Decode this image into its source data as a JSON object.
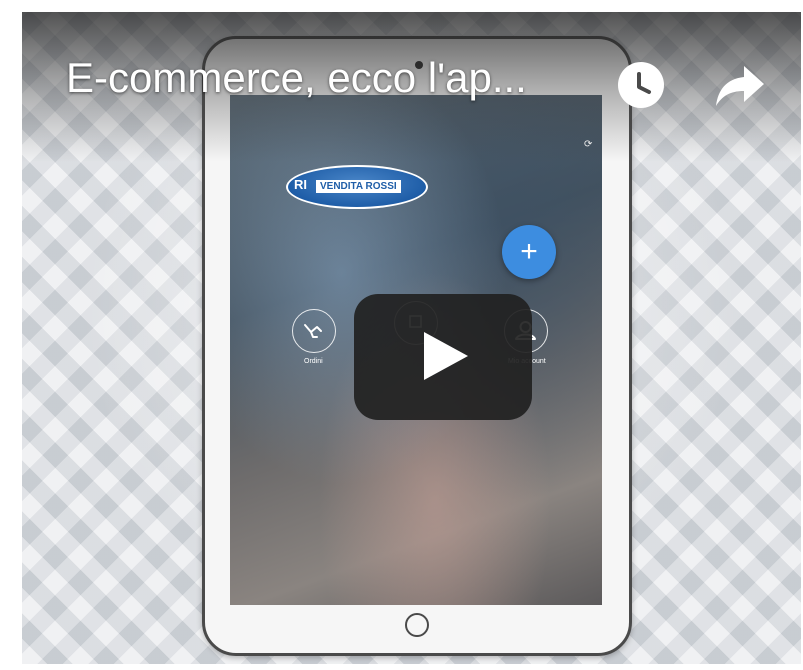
{
  "video": {
    "title": "E-commerce, ecco l'ap...",
    "watch_later_icon": "clock-icon",
    "share_icon": "share-arrow-icon",
    "play_icon": "play-icon"
  },
  "app_screen": {
    "logo_prefix": "RI",
    "logo_text": "VENDITA ROSSI",
    "fab_label": "+",
    "buttons": [
      {
        "label": "Ordini",
        "icon": "order-icon"
      },
      {
        "label": "",
        "icon": "catalog-icon"
      },
      {
        "label": "Mio account",
        "icon": "account-icon"
      }
    ]
  },
  "colors": {
    "fab": "#3d8de0",
    "logo_blue": "#1f5ea8",
    "play_bg": "#212121"
  }
}
